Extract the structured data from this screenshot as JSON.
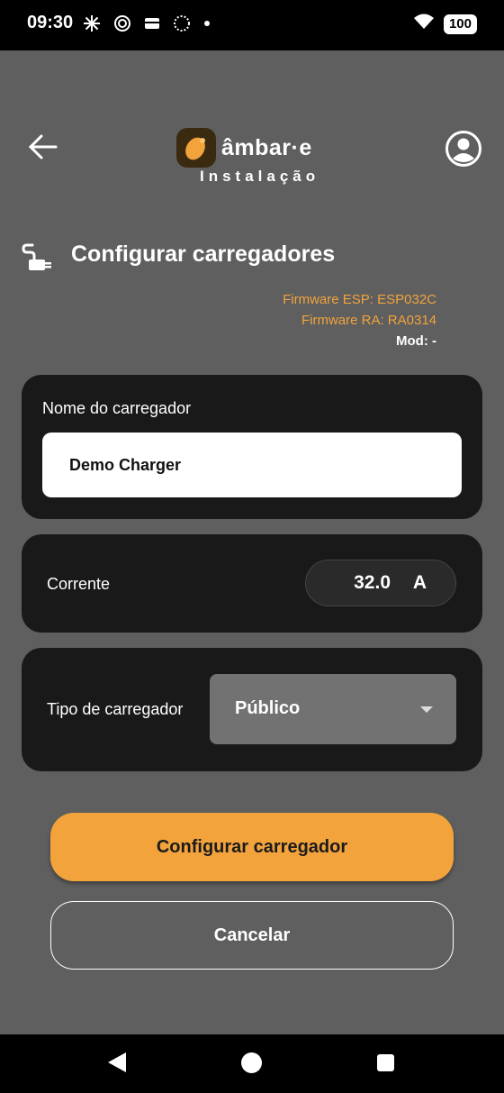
{
  "status_bar": {
    "time": "09:30",
    "battery": "100",
    "icons": [
      "asterisk-icon",
      "target-icon",
      "wallet-icon",
      "dotted-circle-icon",
      "dot-icon",
      "wifi-icon",
      "battery-icon"
    ]
  },
  "header": {
    "brand_name": "âmbar·e",
    "subtitle": "Instalação",
    "brand_color": "#f2a33c"
  },
  "page": {
    "title": "Configurar carregadores"
  },
  "firmware": {
    "esp": "Firmware ESP: ESP032C",
    "ra": "Firmware RA: RA0314",
    "mod": "Mod: -"
  },
  "charger_name": {
    "label": "Nome do carregador",
    "value": "Demo Charger"
  },
  "current": {
    "label": "Corrente",
    "value": "32.0",
    "unit": "A"
  },
  "charger_type": {
    "label": "Tipo de carregador",
    "selected": "Público"
  },
  "actions": {
    "configure": "Configurar carregador",
    "cancel": "Cancelar"
  },
  "colors": {
    "background": "#5f5f5f",
    "card": "#191919",
    "accent": "#f2a33c"
  }
}
